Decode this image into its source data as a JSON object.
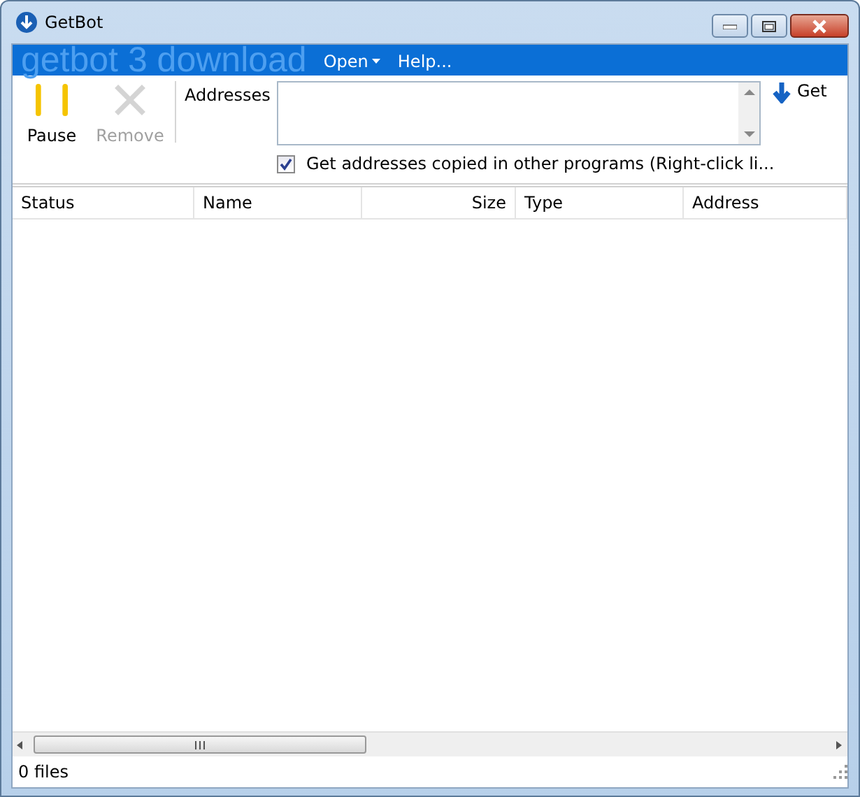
{
  "window": {
    "title": "GetBot"
  },
  "banner": {
    "logo": "getbot 3 download",
    "menus": [
      {
        "label": "Open",
        "dropdown": true
      },
      {
        "label": "Help...",
        "dropdown": false
      }
    ]
  },
  "toolbar": [
    {
      "kind": "pause",
      "label": "Pause",
      "disabled": false
    },
    {
      "kind": "remove",
      "label": "Remove",
      "disabled": true
    }
  ],
  "addresses": {
    "label": "Addresses",
    "get_button": "Get",
    "clipboard": {
      "label": "Get addresses copied in other programs (Right-click li...",
      "checked": true
    }
  },
  "table": {
    "columns": [
      {
        "label": "Status"
      },
      {
        "label": "Name"
      },
      {
        "label": "Size"
      },
      {
        "label": "Type"
      },
      {
        "label": "Address"
      }
    ]
  },
  "status_bar": {
    "text": "0 files"
  }
}
